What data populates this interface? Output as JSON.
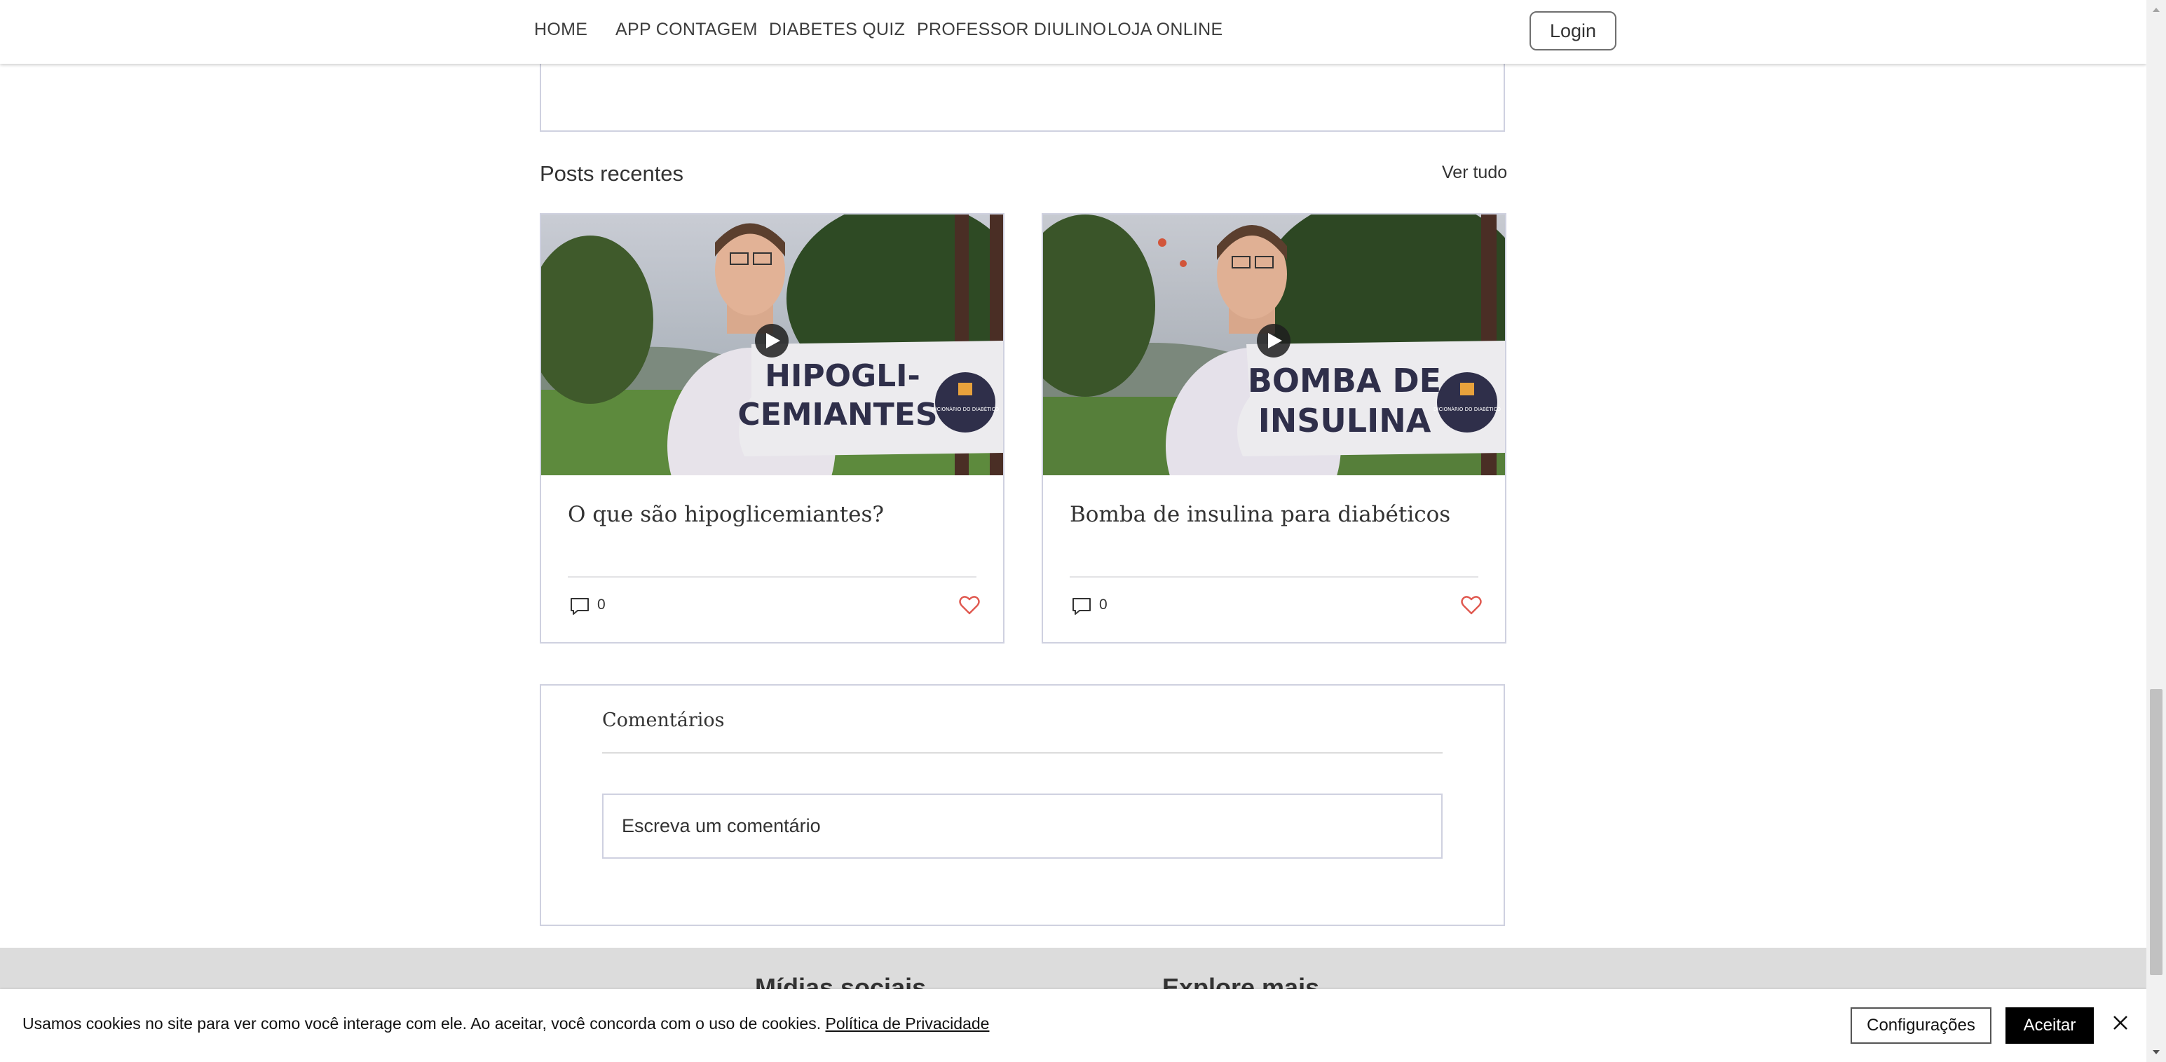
{
  "nav": {
    "items": [
      "HOME",
      "APP CONTAGEM",
      "DIABETES QUIZ",
      "PROFESSOR DIULINO",
      "LOJA ONLINE"
    ],
    "login_label": "Login"
  },
  "posts": {
    "section_title": "Posts recentes",
    "see_all_label": "Ver tudo",
    "items": [
      {
        "title": "O que são hipoglicemiantes?",
        "image_text_line1": "HIPOGLI-",
        "image_text_line2": "CEMIANTES",
        "badge_text": "DICIONÁRIO DO DIABÉTICO",
        "comments": "0"
      },
      {
        "title": "Bomba de insulina para diabéticos",
        "image_text_line1": "BOMBA DE",
        "image_text_line2": "INSULINA",
        "badge_text": "DICIONÁRIO DO DIABÉTICO",
        "comments": "0"
      }
    ]
  },
  "comments": {
    "title": "Comentários",
    "input_placeholder": "Escreva um comentário"
  },
  "footer": {
    "social_heading": "Mídias sociais",
    "explore_heading": "Explore mais"
  },
  "cookie": {
    "text": "Usamos cookies no site para ver como você interage com ele. Ao aceitar, você concorda com o uso de cookies.",
    "link_label": "Política de Privacidade",
    "settings_label": "Configurações",
    "accept_label": "Aceitar"
  },
  "colors": {
    "card_border": "#cfd1e0",
    "heart": "#e0584f",
    "footer_bg": "#dcdcdc",
    "accept_bg": "#000000",
    "badge_bg": "#2f2f4a"
  }
}
